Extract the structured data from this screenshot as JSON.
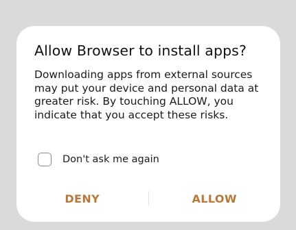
{
  "dialog": {
    "title": "Allow Browser to install apps?",
    "message": "Downloading apps from external sources may put your device and personal data at greater risk. By touching ALLOW, you indicate that you accept these risks.",
    "checkbox": {
      "label": "Don't ask me again",
      "checked": false
    },
    "buttons": {
      "deny": "DENY",
      "allow": "ALLOW"
    }
  },
  "colors": {
    "accent": "#b77838",
    "backdrop": "#dadada",
    "surface": "#ffffff"
  }
}
